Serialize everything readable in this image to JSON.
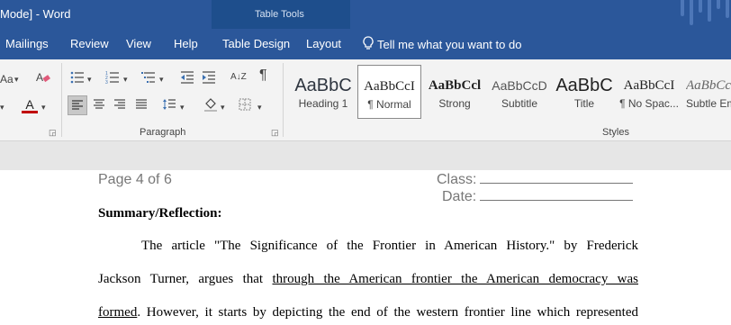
{
  "titlebar": {
    "title": "Mode]  -  Word",
    "contextual_group": "Table Tools"
  },
  "tabs": [
    "Mailings",
    "Review",
    "View",
    "Help",
    "Table Design",
    "Layout"
  ],
  "tell_me": "Tell me what you want to do",
  "ribbon": {
    "paragraph_label": "Paragraph",
    "styles_label": "Styles",
    "styles": [
      {
        "preview": "AaBbC",
        "name": "Heading 1"
      },
      {
        "preview": "AaBbCcI",
        "name": "¶ Normal"
      },
      {
        "preview": "AaBbCcl",
        "name": "Strong"
      },
      {
        "preview": "AaBbCcD",
        "name": "Subtitle"
      },
      {
        "preview": "AaBbC",
        "name": "Title"
      },
      {
        "preview": "AaBbCcI",
        "name": "¶ No Spac..."
      },
      {
        "preview": "AaBbCc",
        "name": "Subtle Em"
      }
    ],
    "font_size_partial": "Aa",
    "sort_icon": "A↓Z",
    "pilcrow": "¶",
    "font_color_glyph": "A"
  },
  "document": {
    "page_label": "Page 4 of 6",
    "class_label": "Class:",
    "date_label": "Date:",
    "heading": "Summary/Reflection:",
    "line1": "The article \"The Significance of the Frontier in American History.\" by Frederick",
    "line2_a": "Jackson Turner, argues that ",
    "line2_b": "through the American frontier the American democracy was",
    "line3_a": "formed",
    "line3_b": ". However, it starts by depicting the end of the western frontier line which represented"
  },
  "colors": {
    "titlebar": "#2b579a",
    "contextual": "#1e4e8c",
    "ribbon": "#f3f3f3",
    "font_color_red": "#c00000"
  }
}
